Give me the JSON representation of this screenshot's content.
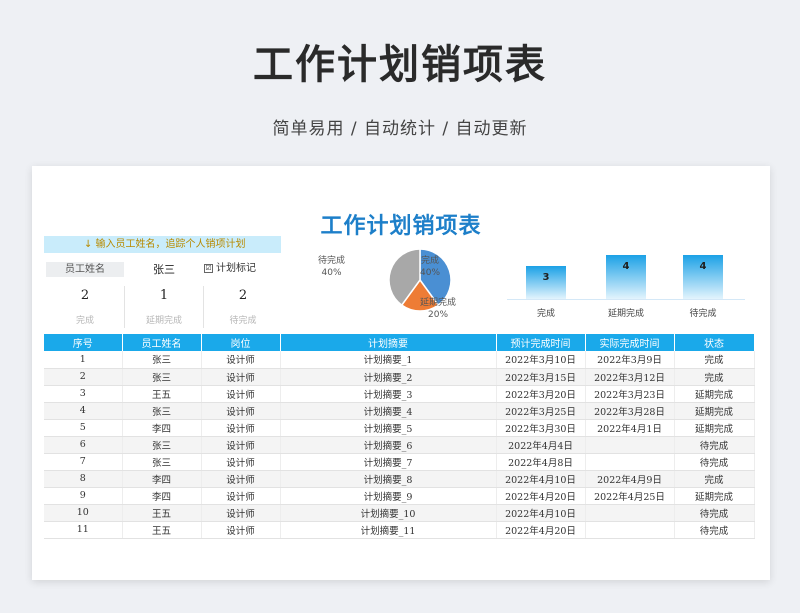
{
  "header": {
    "title": "工作计划销项表",
    "subtitle": "简单易用  /  自动统计  /  自动更新"
  },
  "sheet": {
    "title": "工作计划销项表",
    "hint": "↓ 输入员工姓名，追踪个人销项计划",
    "employee_label": "员工姓名",
    "employee_name": "张三",
    "mark_checkbox": "☑",
    "mark_label": "计划标记",
    "stats": [
      {
        "value": "2",
        "label": "完成"
      },
      {
        "value": "1",
        "label": "延期完成"
      },
      {
        "value": "2",
        "label": "待完成"
      }
    ]
  },
  "charts": {
    "pie": {
      "type": "pie",
      "slices": [
        {
          "name": "完成",
          "percent": 40,
          "label": "40%",
          "color": "#4a8fd3"
        },
        {
          "name": "延期完成",
          "percent": 20,
          "label": "20%",
          "color": "#ee7c35"
        },
        {
          "name": "待完成",
          "percent": 40,
          "label": "40%",
          "color": "#a8a8a8"
        }
      ]
    },
    "bar": {
      "type": "bar",
      "categories": [
        "完成",
        "延期完成",
        "待完成"
      ],
      "values": [
        3,
        4,
        4
      ],
      "labels": [
        "3",
        "4",
        "4"
      ],
      "ylim": [
        0,
        4
      ]
    }
  },
  "table": {
    "headers": [
      "序号",
      "员工姓名",
      "岗位",
      "计划摘要",
      "预计完成时间",
      "实际完成时间",
      "状态"
    ],
    "rows": [
      [
        "1",
        "张三",
        "设计师",
        "计划摘要_1",
        "2022年3月10日",
        "2022年3月9日",
        "完成"
      ],
      [
        "2",
        "张三",
        "设计师",
        "计划摘要_2",
        "2022年3月15日",
        "2022年3月12日",
        "完成"
      ],
      [
        "3",
        "王五",
        "设计师",
        "计划摘要_3",
        "2022年3月20日",
        "2022年3月23日",
        "延期完成"
      ],
      [
        "4",
        "张三",
        "设计师",
        "计划摘要_4",
        "2022年3月25日",
        "2022年3月28日",
        "延期完成"
      ],
      [
        "5",
        "李四",
        "设计师",
        "计划摘要_5",
        "2022年3月30日",
        "2022年4月1日",
        "延期完成"
      ],
      [
        "6",
        "张三",
        "设计师",
        "计划摘要_6",
        "2022年4月4日",
        "",
        "待完成"
      ],
      [
        "7",
        "张三",
        "设计师",
        "计划摘要_7",
        "2022年4月8日",
        "",
        "待完成"
      ],
      [
        "8",
        "李四",
        "设计师",
        "计划摘要_8",
        "2022年4月10日",
        "2022年4月9日",
        "完成"
      ],
      [
        "9",
        "李四",
        "设计师",
        "计划摘要_9",
        "2022年4月20日",
        "2022年4月25日",
        "延期完成"
      ],
      [
        "10",
        "王五",
        "设计师",
        "计划摘要_10",
        "2022年4月10日",
        "",
        "待完成"
      ],
      [
        "11",
        "王五",
        "设计师",
        "计划摘要_11",
        "2022年4月20日",
        "",
        "待完成"
      ]
    ]
  }
}
